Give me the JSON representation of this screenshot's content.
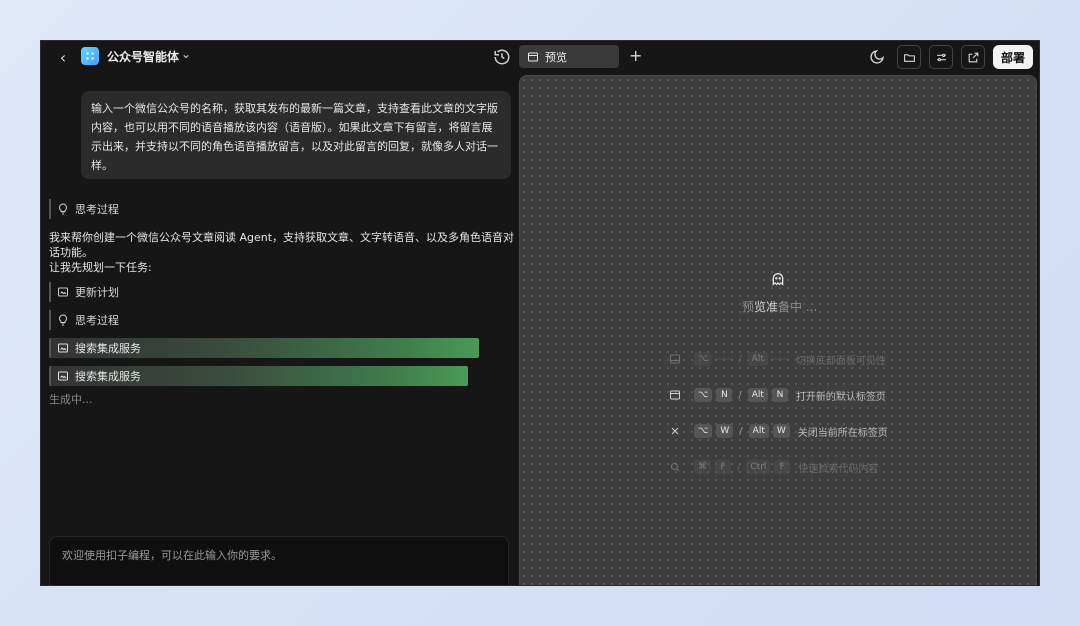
{
  "header": {
    "agent_name": "公众号智能体"
  },
  "chat": {
    "user_message": "输入一个微信公众号的名称，获取其发布的最新一篇文章，支持查看此文章的文字版内容，也可以用不同的语音播放该内容（语音版）。如果此文章下有留言，将留言展示出来，并支持以不同的角色语音播放留言，以及对此留言的回复，就像多人对话一样。",
    "think1": "思考过程",
    "answer_line1": "我来帮你创建一个微信公众号文章阅读 Agent，支持获取文章、文字转语音、以及多角色语音对话功能。",
    "answer_line2": "让我先规划一下任务:",
    "update_plan": "更新计划",
    "think2": "思考过程",
    "task1": "搜索集成服务",
    "task2": "搜索集成服务",
    "generating": "生成中...",
    "input_placeholder": "欢迎使用扣子编程，可以在此输入你的要求。"
  },
  "preview": {
    "tab_label": "预览",
    "deploy_label": "部署",
    "ready_bright": "览准",
    "ready_pre": "预",
    "ready_post": "备中 ...",
    "shortcuts": [
      {
        "k1": "⌥",
        "k2": "",
        "k3": "Alt",
        "k4": "",
        "label": "切换底部面板可见性"
      },
      {
        "k1": "⌥",
        "k2": "N",
        "k3": "Alt",
        "k4": "N",
        "label": "打开新的默认标签页"
      },
      {
        "k1": "⌥",
        "k2": "W",
        "k3": "Alt",
        "k4": "W",
        "label": "关闭当前所在标签页"
      },
      {
        "k1": "⌘",
        "k2": "F",
        "k3": "Ctrl",
        "k4": "F",
        "label": "快速检索代码内容"
      }
    ]
  }
}
